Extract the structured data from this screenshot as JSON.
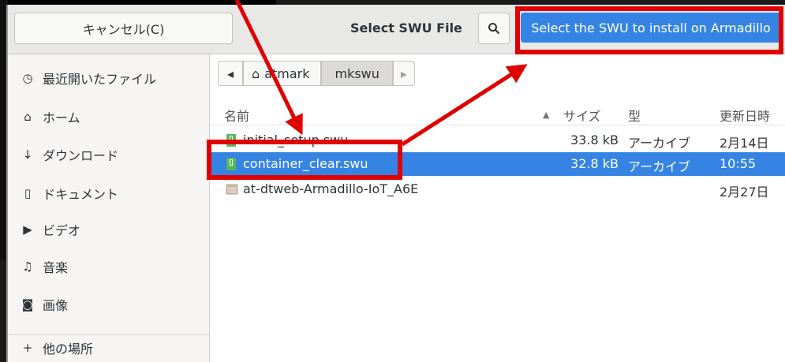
{
  "header": {
    "cancel_label": "キャンセル(C)",
    "title": "Select SWU File",
    "select_label": "Select the SWU to install on Armadillo"
  },
  "sidebar": {
    "items": [
      {
        "icon": "clock-icon",
        "label": "最近開いたファイル"
      },
      {
        "icon": "home-icon",
        "label": "ホーム"
      },
      {
        "icon": "download-icon",
        "label": "ダウンロード"
      },
      {
        "icon": "document-icon",
        "label": "ドキュメント"
      },
      {
        "icon": "video-icon",
        "label": "ビデオ"
      },
      {
        "icon": "music-icon",
        "label": "音楽"
      },
      {
        "icon": "camera-icon",
        "label": "画像"
      },
      {
        "icon": "plus-icon",
        "label": "他の場所"
      }
    ]
  },
  "pathbar": {
    "segments": [
      "atmark",
      "mkswu"
    ]
  },
  "columns": {
    "name": "名前",
    "size": "サイズ",
    "type": "型",
    "modified": "更新日時"
  },
  "files": [
    {
      "name": "initial_setup.swu",
      "size": "33.8 kB",
      "type": "アーカイブ",
      "modified": "2月14日",
      "kind": "archive"
    },
    {
      "name": "container_clear.swu",
      "size": "32.8 kB",
      "type": "アーカイブ",
      "modified": "10:55",
      "kind": "archive",
      "selected": true
    },
    {
      "name": "at-dtweb-Armadillo-IoT_A6E",
      "size": "",
      "type": "",
      "modified": "2月27日",
      "kind": "folder"
    }
  ],
  "colors": {
    "accent": "#3584e4",
    "annotation": "#e00000"
  }
}
